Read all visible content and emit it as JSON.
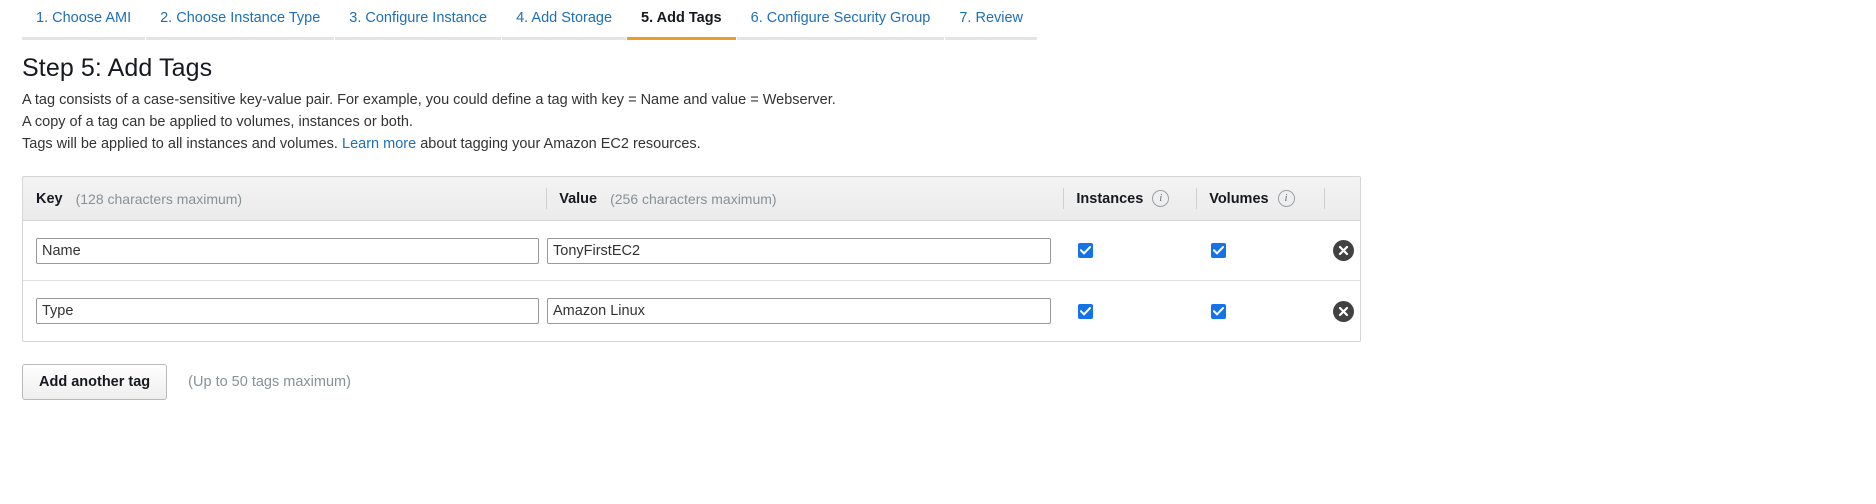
{
  "wizard": {
    "tabs": [
      {
        "label": "1. Choose AMI",
        "active": false
      },
      {
        "label": "2. Choose Instance Type",
        "active": false
      },
      {
        "label": "3. Configure Instance",
        "active": false
      },
      {
        "label": "4. Add Storage",
        "active": false
      },
      {
        "label": "5. Add Tags",
        "active": true
      },
      {
        "label": "6. Configure Security Group",
        "active": false
      },
      {
        "label": "7. Review",
        "active": false
      }
    ],
    "active_tab_index": 4,
    "active_underline_color": "#ec9d28",
    "link_color": "#1e6fb8"
  },
  "page": {
    "title": "Step 5: Add Tags",
    "description_line_1": "A tag consists of a case-sensitive key-value pair. For example, you could define a tag with key = Name and value = Webserver.",
    "description_line_2": "A copy of a tag can be applied to volumes, instances or both.",
    "description_line_3_before": "Tags will be applied to all instances and volumes.",
    "description_link": "Learn more",
    "description_line_3_after": "about tagging your Amazon EC2 resources."
  },
  "table": {
    "headers": {
      "key": {
        "label": "Key",
        "hint": "(128 characters maximum)"
      },
      "value": {
        "label": "Value",
        "hint": "(256 characters maximum)"
      },
      "instances": {
        "label": "Instances",
        "info": "i"
      },
      "volumes": {
        "label": "Volumes",
        "info": "i"
      }
    },
    "rows": [
      {
        "key": "Name",
        "value": "TonyFirstEC2",
        "key_placeholder": "",
        "value_placeholder": "",
        "instances_checked": true,
        "volumes_checked": true,
        "remove_icon": "close-circle-icon"
      },
      {
        "key": "Type",
        "value": "Amazon Linux",
        "key_placeholder": "",
        "value_placeholder": "",
        "instances_checked": true,
        "volumes_checked": true,
        "remove_icon": "close-circle-icon"
      }
    ],
    "checkbox_color": "#1473e6"
  },
  "footer": {
    "add_tag_label": "Add another tag",
    "max_hint": "(Up to 50 tags maximum)"
  }
}
